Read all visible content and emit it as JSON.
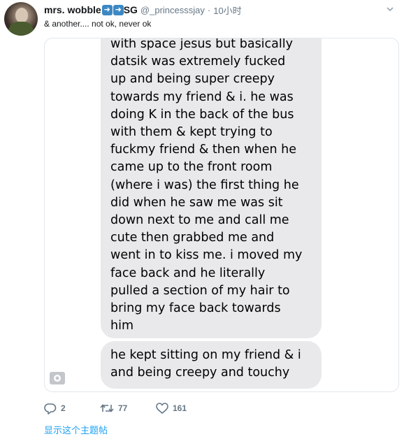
{
  "tweet": {
    "display_name": "mrs. wobble",
    "name_suffix": "SG",
    "handle": "@_princesssjay",
    "separator": "·",
    "time": "10小时",
    "text": "& another.... not ok, never ok"
  },
  "media": {
    "bubble1_lines": [
      "with space jesus but basically",
      "datsik was extremely fucked",
      "up and being super creepy",
      "towards my friend & i. he was",
      "doing K in the back of the bus",
      "with them &  kept trying to",
      "fuckmy friend & then when he",
      "came up to the front room",
      "(where i was) the first thing he",
      "did when he saw me was sit",
      "down next to me and call me",
      "cute then grabbed me and",
      "went in to kiss me. i moved my",
      "face back and he literally",
      "pulled a section of my hair to",
      "bring my face back towards",
      "him"
    ],
    "bubble2_lines": [
      "he kept sitting on my friend & i",
      "and being creepy and touchy"
    ]
  },
  "actions": {
    "reply_count": "2",
    "retweet_count": "77",
    "like_count": "161"
  },
  "show_thread_label": "显示这个主题帖",
  "colors": {
    "accent": "#1da1f2",
    "secondary_text": "#657786",
    "bubble": "#e9e9eb"
  },
  "icons": [
    "reply-icon",
    "retweet-icon",
    "like-icon",
    "caret-down-icon",
    "gif-badge-icon",
    "arrow-emoji-icon"
  ]
}
